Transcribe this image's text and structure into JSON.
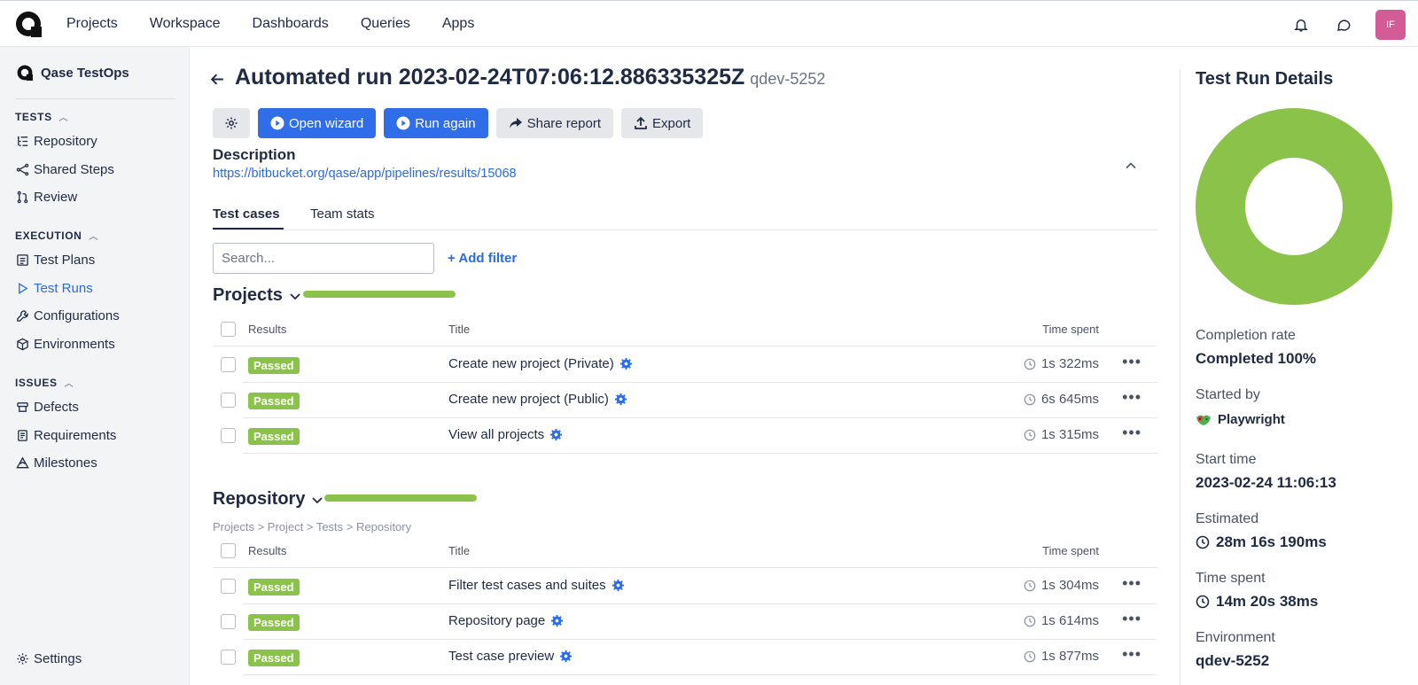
{
  "topnav": {
    "items": [
      "Projects",
      "Workspace",
      "Dashboards",
      "Queries",
      "Apps"
    ],
    "avatar_initials": "IF"
  },
  "sidebar": {
    "brand": "Qase TestOps",
    "sections": {
      "tests": "TESTS",
      "execution": "EXECUTION",
      "issues": "ISSUES"
    },
    "items": {
      "repository": "Repository",
      "shared_steps": "Shared Steps",
      "review": "Review",
      "test_plans": "Test Plans",
      "test_runs": "Test Runs",
      "configurations": "Configurations",
      "environments": "Environments",
      "defects": "Defects",
      "requirements": "Requirements",
      "milestones": "Milestones",
      "settings": "Settings"
    },
    "active_item": "Test Runs"
  },
  "header": {
    "title": "Automated run 2023-02-24T07:06:12.886335325Z",
    "env_code": "qdev-5252"
  },
  "toolbar": {
    "open_wizard": "Open wizard",
    "run_again": "Run again",
    "share_report": "Share report",
    "export": "Export"
  },
  "description": {
    "heading": "Description",
    "link": "https://bitbucket.org/qase/app/pipelines/results/15068"
  },
  "tabs": [
    "Test cases",
    "Team stats"
  ],
  "search": {
    "placeholder": "Search..."
  },
  "add_filter": "+ Add filter",
  "columns": {
    "results": "Results",
    "title": "Title",
    "time": "Time spent"
  },
  "groups": [
    {
      "name": "Projects",
      "progress": 1.0,
      "rows": [
        {
          "status": "Passed",
          "title": "Create new project (Private)",
          "time": "1s 322ms"
        },
        {
          "status": "Passed",
          "title": "Create new project (Public)",
          "time": "6s 645ms"
        },
        {
          "status": "Passed",
          "title": "View all projects",
          "time": "1s 315ms"
        }
      ]
    },
    {
      "name": "Repository",
      "progress": 1.0,
      "breadcrumb": "Projects > Project > Tests > Repository",
      "rows": [
        {
          "status": "Passed",
          "title": "Filter test cases and suites",
          "time": "1s 304ms"
        },
        {
          "status": "Passed",
          "title": "Repository page",
          "time": "1s 614ms"
        },
        {
          "status": "Passed",
          "title": "Test case preview",
          "time": "1s 877ms"
        }
      ]
    }
  ],
  "details": {
    "title": "Test Run Details",
    "completion_label": "Completion rate",
    "completion_value": "Completed 100%",
    "completion_rate": 1.0,
    "started_by_label": "Started by",
    "started_by_value": "Playwright",
    "start_time_label": "Start time",
    "start_time_value": "2023-02-24 11:06:13",
    "estimated_label": "Estimated",
    "estimated_value": "28m 16s 190ms",
    "time_spent_label": "Time spent",
    "time_spent_value": "14m 20s 38ms",
    "environment_label": "Environment",
    "environment_value": "qdev-5252"
  },
  "colors": {
    "accent_blue": "#2f6ee8",
    "passed_green": "#8bc34a",
    "text_dark": "#1f2a44"
  }
}
